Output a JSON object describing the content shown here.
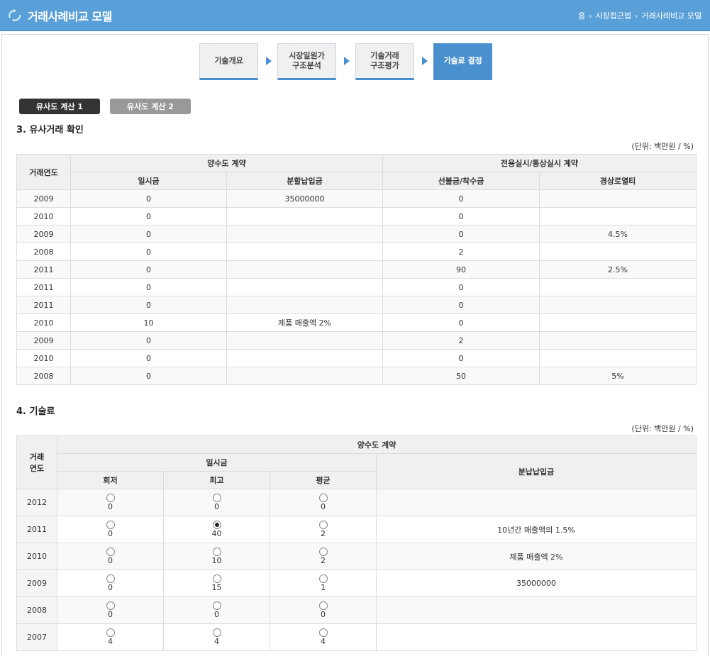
{
  "header": {
    "title": "거래사례비교 모델",
    "breadcrumb": [
      "홈",
      "시장접근법",
      "거래사례비교 모델"
    ]
  },
  "steps": [
    {
      "line1": "기술개요",
      "line2": ""
    },
    {
      "line1": "시장일원가",
      "line2": "구조분석"
    },
    {
      "line1": "기술거래",
      "line2": "구조평가"
    },
    {
      "line1": "기술료 결정",
      "line2": ""
    }
  ],
  "tabs": [
    "유사도 계산 1",
    "유사도 계산 2"
  ],
  "section3": {
    "title": "3. 유사거래 확인",
    "unit": "(단위: 백만원 / %)",
    "headers": {
      "year": "거래연도",
      "group1": "양수도 계약",
      "group2": "전용실시/통상실시 계약",
      "lump": "일시금",
      "install": "분할납입금",
      "advance": "선불금/착수금",
      "royalty": "경상로열티"
    },
    "rows": [
      {
        "year": "2009",
        "lump": "0",
        "install": "35000000",
        "advance": "0",
        "royalty": ""
      },
      {
        "year": "2010",
        "lump": "0",
        "install": "",
        "advance": "0",
        "royalty": ""
      },
      {
        "year": "2009",
        "lump": "0",
        "install": "",
        "advance": "0",
        "royalty": "4.5%"
      },
      {
        "year": "2008",
        "lump": "0",
        "install": "",
        "advance": "2",
        "royalty": ""
      },
      {
        "year": "2011",
        "lump": "0",
        "install": "",
        "advance": "90",
        "royalty": "2.5%"
      },
      {
        "year": "2011",
        "lump": "0",
        "install": "",
        "advance": "0",
        "royalty": ""
      },
      {
        "year": "2011",
        "lump": "0",
        "install": "",
        "advance": "0",
        "royalty": ""
      },
      {
        "year": "2010",
        "lump": "10",
        "install": "제품 매출액 2%",
        "advance": "0",
        "royalty": ""
      },
      {
        "year": "2009",
        "lump": "0",
        "install": "",
        "advance": "2",
        "royalty": ""
      },
      {
        "year": "2010",
        "lump": "0",
        "install": "",
        "advance": "0",
        "royalty": ""
      },
      {
        "year": "2008",
        "lump": "0",
        "install": "",
        "advance": "50",
        "royalty": "5%"
      }
    ]
  },
  "section4": {
    "title": "4. 기술료",
    "unit": "(단위: 백만원 / %)",
    "headers": {
      "year_line1": "거래",
      "year_line2": "연도",
      "group": "양수도 계약",
      "lump": "일시금",
      "install": "분납납입금",
      "min": "회저",
      "max": "최고",
      "avg": "평균"
    },
    "rows": [
      {
        "year": "2012",
        "min": "0",
        "max": "0",
        "avg": "0",
        "install": "",
        "selected": ""
      },
      {
        "year": "2011",
        "min": "0",
        "max": "40",
        "avg": "2",
        "install": "10년간 매출액의 1.5%",
        "selected": "max"
      },
      {
        "year": "2010",
        "min": "0",
        "max": "10",
        "avg": "2",
        "install": "제품 매출액 2%",
        "selected": ""
      },
      {
        "year": "2009",
        "min": "0",
        "max": "15",
        "avg": "1",
        "install": "35000000",
        "selected": ""
      },
      {
        "year": "2008",
        "min": "0",
        "max": "0",
        "avg": "0",
        "install": "",
        "selected": ""
      },
      {
        "year": "2007",
        "min": "4",
        "max": "4",
        "avg": "4",
        "install": "",
        "selected": ""
      }
    ]
  },
  "colors": {
    "header": "#5aa0d8",
    "accent": "#4a90cf",
    "tab_active": "#333333",
    "tab_inactive": "#999999"
  },
  "icons": {
    "logo": "recycle-logo-icon",
    "breadcrumb_sep": "chevron-right-icon",
    "step_arrow": "arrow-right-icon"
  }
}
